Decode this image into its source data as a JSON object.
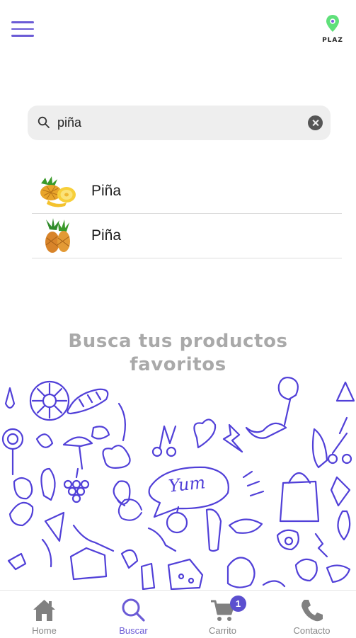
{
  "header": {
    "logo_text": "PLAZ",
    "menu_icon": "hamburger-icon",
    "logo_icon": "location-pin-icon"
  },
  "search": {
    "value": "piña",
    "icon": "search-icon",
    "clear_icon": "close-icon"
  },
  "results": [
    {
      "label": "Piña",
      "icon": "pineapple-slices-image"
    },
    {
      "label": "Piña",
      "icon": "whole-pineapples-image"
    }
  ],
  "tagline": {
    "line1": "Busca tus productos",
    "line2": "favoritos"
  },
  "doodle_word": "Yum",
  "bottom_nav": {
    "items": [
      {
        "label": "Home",
        "icon": "home-icon",
        "active": false
      },
      {
        "label": "Buscar",
        "icon": "search-icon",
        "active": true
      },
      {
        "label": "Carrito",
        "icon": "cart-icon",
        "active": false
      },
      {
        "label": "Contacto",
        "icon": "phone-icon",
        "active": false
      }
    ],
    "cart_badge": "1"
  },
  "colors": {
    "accent": "#6b5bd6",
    "doodle": "#5140d8",
    "muted_text": "#a9a9a9",
    "nav_gray": "#888888"
  }
}
